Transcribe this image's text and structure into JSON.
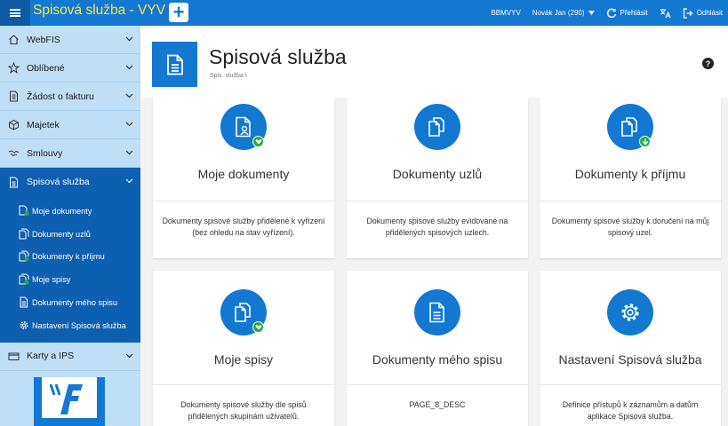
{
  "topbar": {
    "app_title": "Spisová služba - VYV",
    "new_button": "+",
    "db_name": "BBMVYV",
    "user": "Novák Jan (290)",
    "relogin": "Přehlásit",
    "logout": "Odhlásit"
  },
  "sidebar": {
    "items": [
      {
        "label": "WebFIS",
        "icon": "home-icon"
      },
      {
        "label": "Oblíbené",
        "icon": "star-icon"
      },
      {
        "label": "Žádost o fakturu",
        "icon": "document-icon"
      },
      {
        "label": "Majetek",
        "icon": "box-icon"
      },
      {
        "label": "Smlouvy",
        "icon": "handshake-icon"
      },
      {
        "label": "Spisová služba",
        "icon": "document-icon"
      },
      {
        "label": "Karty a IPS",
        "icon": "card-icon"
      }
    ],
    "submenu": [
      {
        "label": "Moje dokumenty",
        "icon": "user-document-icon"
      },
      {
        "label": "Dokumenty uzlů",
        "icon": "documents-icon"
      },
      {
        "label": "Dokumenty k příjmu",
        "icon": "documents-download-icon"
      },
      {
        "label": "Moje spisy",
        "icon": "documents-check-icon"
      },
      {
        "label": "Dokumenty mého spisu",
        "icon": "document-icon"
      },
      {
        "label": "Nastavení Spisová služba",
        "icon": "gear-icon"
      }
    ]
  },
  "header": {
    "title": "Spisová služba",
    "breadcrumb": "Spis. služba  \\"
  },
  "cards": [
    {
      "title": "Moje dokumenty",
      "description": "Dokumenty spisové služby přidělené k vyřízení (bez ohledu na stav vyřízení).",
      "icon": "user-document-icon",
      "badge": "check-badge-icon"
    },
    {
      "title": "Dokumenty uzlů",
      "description": "Dokumenty spisové služby evidované na přidělených spisových uzlech.",
      "icon": "documents-icon",
      "badge": ""
    },
    {
      "title": "Dokumenty k příjmu",
      "description": "Dokumenty spisové služby k doručení na můj spisový uzel.",
      "icon": "documents-icon",
      "badge": "download-badge-icon"
    },
    {
      "title": "Moje spisy",
      "description": "Dokumenty spisové služby dle spisů přidělených skupinám uživatelů.",
      "icon": "documents-icon",
      "badge": "check-badge-icon"
    },
    {
      "title": "Dokumenty mého spisu",
      "description": "PAGE_8_DESC",
      "icon": "document-icon",
      "badge": ""
    },
    {
      "title": "Nastavení Spisová služba",
      "description": "Definice přístupů k záznamům a datům aplikace Spisová služba.",
      "icon": "gear-icon",
      "badge": ""
    }
  ],
  "colors": {
    "primary": "#1278d2",
    "sidebar_bg": "#bedff6",
    "sidebar_active": "#0d5fb1",
    "title_accent": "#ffe24a",
    "badge_green": "#1fae3e"
  }
}
